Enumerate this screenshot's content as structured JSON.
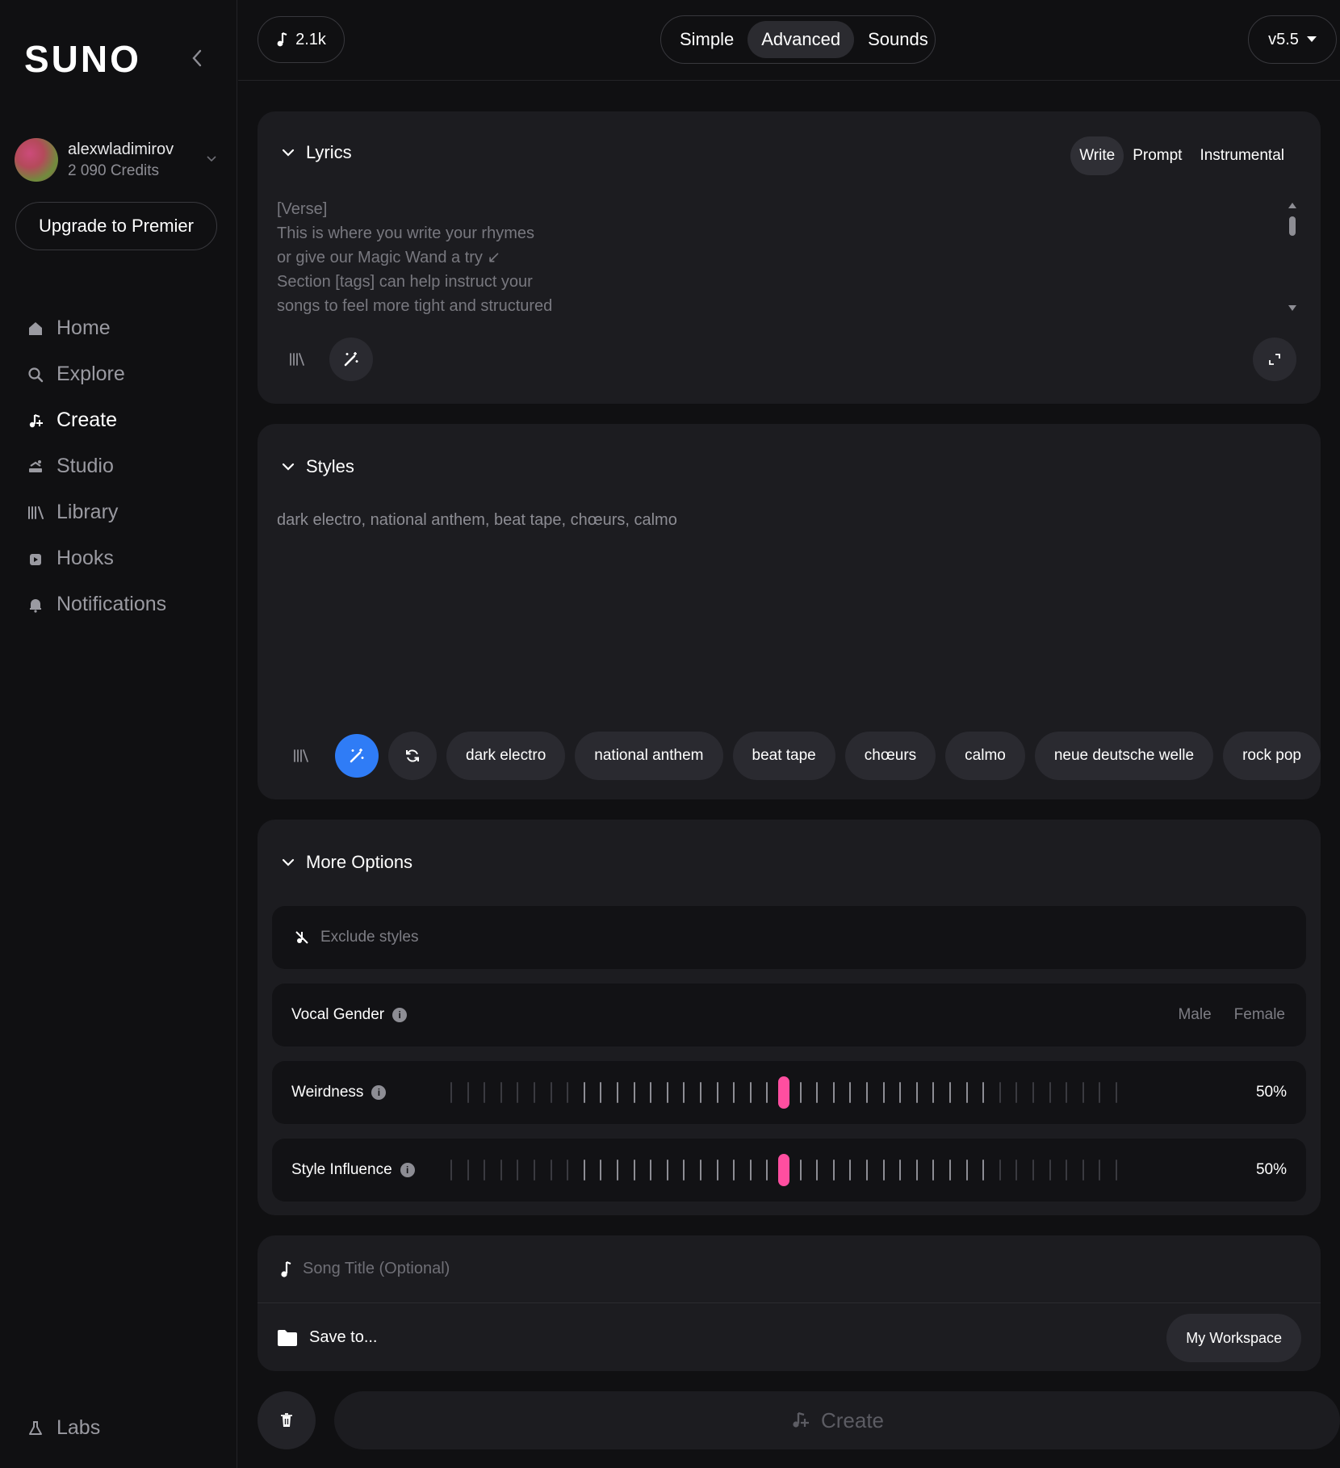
{
  "sidebar": {
    "logo": "SUNO",
    "user": {
      "name": "alexwladimirov",
      "credits": "2 090 Credits"
    },
    "upgrade_label": "Upgrade to Premier",
    "nav": [
      {
        "label": "Home",
        "icon": "home-icon"
      },
      {
        "label": "Explore",
        "icon": "search-icon"
      },
      {
        "label": "Create",
        "icon": "music-note-plus-icon",
        "active": true
      },
      {
        "label": "Studio",
        "icon": "studio-icon"
      },
      {
        "label": "Library",
        "icon": "library-icon"
      },
      {
        "label": "Hooks",
        "icon": "hooks-icon"
      },
      {
        "label": "Notifications",
        "icon": "bell-icon"
      }
    ],
    "labs_label": "Labs"
  },
  "topbar": {
    "credits": "2.1k",
    "modes": [
      "Simple",
      "Advanced",
      "Sounds"
    ],
    "active_mode": "Advanced",
    "version": "v5.5"
  },
  "lyrics": {
    "title": "Lyrics",
    "tabs": [
      "Write",
      "Prompt",
      "Instrumental"
    ],
    "active_tab": "Write",
    "placeholder": "[Verse]\nThis is where you write your rhymes\nor give our Magic Wand a try ↙\nSection [tags] can help instruct your\nsongs to feel more tight and structured"
  },
  "styles": {
    "title": "Styles",
    "text": "dark electro, national anthem, beat tape, chœurs, calmo",
    "tags": [
      "dark electro",
      "national anthem",
      "beat tape",
      "chœurs",
      "calmo",
      "neue deutsche welle",
      "rock pop"
    ]
  },
  "more_options": {
    "title": "More Options",
    "exclude_placeholder": "Exclude styles",
    "vocal_gender": {
      "label": "Vocal Gender",
      "options": [
        "Male",
        "Female"
      ]
    },
    "weirdness": {
      "label": "Weirdness",
      "value": "50%",
      "fraction": 0.5
    },
    "style_influence": {
      "label": "Style Influence",
      "value": "50%",
      "fraction": 0.5
    }
  },
  "song": {
    "title_placeholder": "Song Title (Optional)",
    "save_label": "Save to...",
    "workspace": "My Workspace"
  },
  "actions": {
    "create_label": "Create"
  },
  "colors": {
    "accent_blue": "#2f7cf6",
    "slider_pink": "#ff4ea0",
    "background": "#101012",
    "card": "#1c1c20"
  }
}
